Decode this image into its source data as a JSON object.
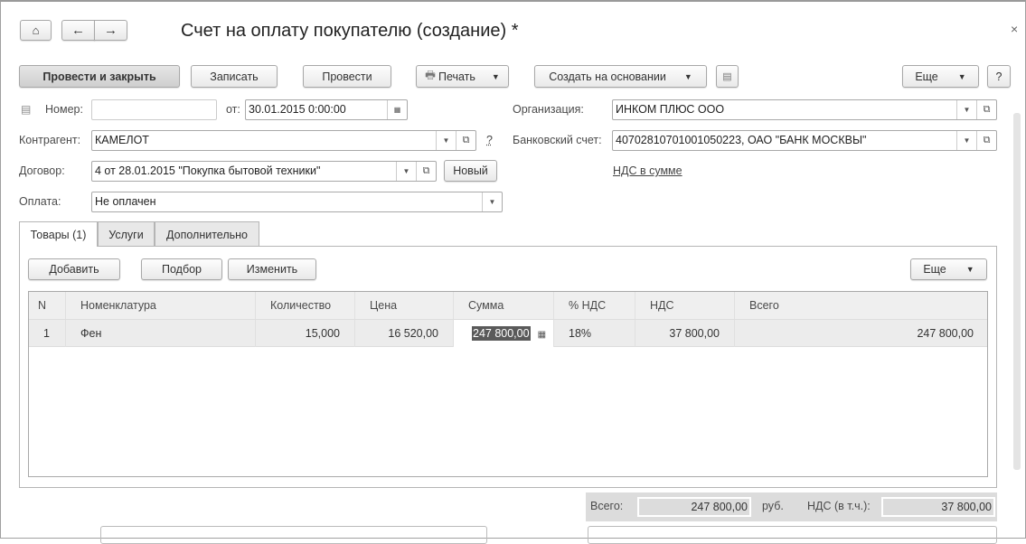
{
  "window": {
    "title": "Счет на оплату покупателю (создание) *",
    "close": "×"
  },
  "nav": {
    "home": "home",
    "back": "←",
    "forward": "→"
  },
  "toolbar": {
    "post_close": "Провести и закрыть",
    "save": "Записать",
    "post": "Провести",
    "print": "Печать",
    "create_based": "Создать на основании",
    "more": "Еще",
    "help": "?"
  },
  "form": {
    "number_label": "Номер:",
    "number_value": "",
    "date_label": "от:",
    "date_value": "30.01.2015  0:00:00",
    "contractor_label": "Контрагент:",
    "contractor_value": "КАМЕЛОТ",
    "contractor_help": "?",
    "contract_label": "Договор:",
    "contract_value": "4 от 28.01.2015 \"Покупка бытовой техники\"",
    "new_button": "Новый",
    "payment_label": "Оплата:",
    "payment_value": "Не оплачен",
    "org_label": "Организация:",
    "org_value": "ИНКОМ ПЛЮС ООО",
    "bank_label": "Банковский счет:",
    "bank_value": "40702810701001050223, ОАО \"БАНК МОСКВЫ\"",
    "vat_link": "НДС в сумме"
  },
  "tabs": [
    {
      "label": "Товары (1)",
      "active": true
    },
    {
      "label": "Услуги"
    },
    {
      "label": "Дополнительно"
    }
  ],
  "table_toolbar": {
    "add": "Добавить",
    "pick": "Подбор",
    "edit": "Изменить",
    "more": "Еще"
  },
  "table": {
    "columns": [
      "N",
      "Номенклатура",
      "Количество",
      "Цена",
      "Сумма",
      "% НДС",
      "НДС",
      "Всего"
    ],
    "rows": [
      [
        "1",
        "Фен",
        "15,000",
        "16 520,00",
        "247 800,00",
        "18%",
        "37 800,00",
        "247 800,00"
      ]
    ]
  },
  "totals": {
    "total_label": "Всего:",
    "total_value": "247 800,00",
    "currency": "руб.",
    "vat_label": "НДС (в т.ч.):",
    "vat_value": "37 800,00"
  }
}
